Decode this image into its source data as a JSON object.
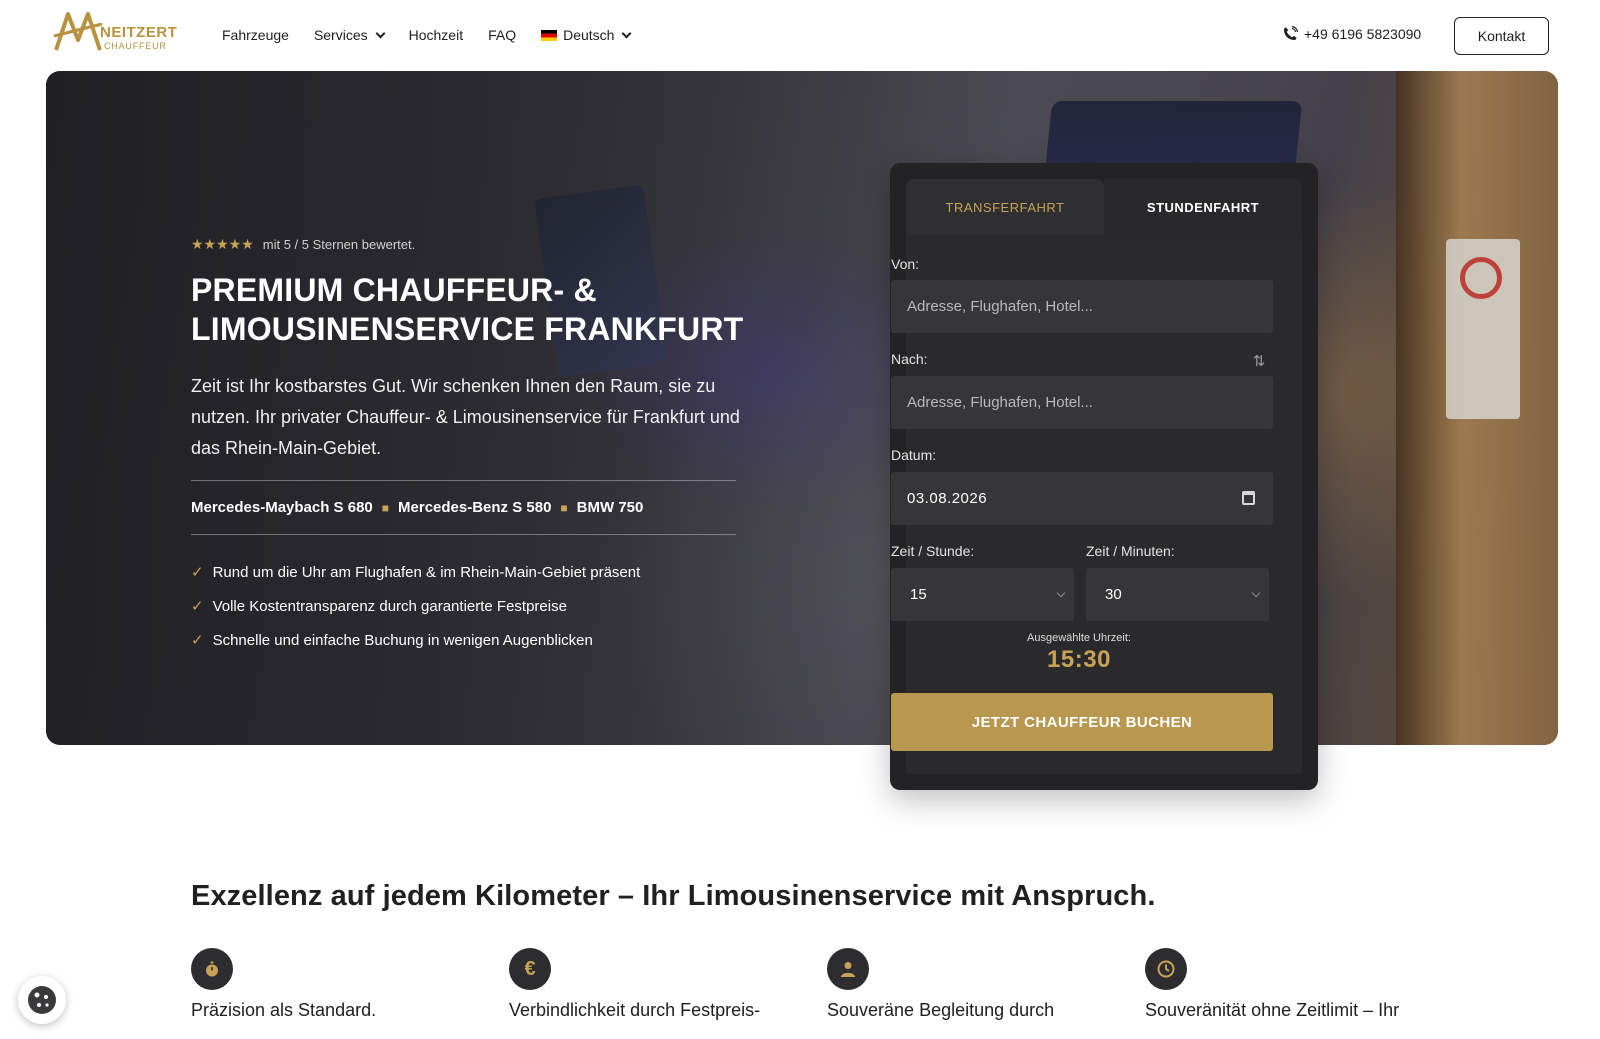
{
  "brand": {
    "name": "NEITZERT",
    "sub": "CHAUFFEUR"
  },
  "nav": {
    "items": [
      {
        "label": "Fahrzeuge",
        "dropdown": false
      },
      {
        "label": "Services",
        "dropdown": true
      },
      {
        "label": "Hochzeit",
        "dropdown": false
      },
      {
        "label": "FAQ",
        "dropdown": false
      }
    ],
    "language": "Deutsch",
    "phone": "+49 6196 5823090",
    "contact_label": "Kontakt"
  },
  "hero": {
    "stars": "★★★★★",
    "rating_text": "mit 5 / 5 Sternen bewertet.",
    "rating_value": 5,
    "rating_max": 5,
    "title_line1": "PREMIUM CHAUFFEUR- &",
    "title_line2": "LIMOUSINENSERVICE FRANKFURT",
    "lead": "Zeit ist Ihr kostbarstes Gut. Wir schenken Ihnen den Raum, sie zu nutzen. Ihr privater Chauffeur- & Limousinenservice für Frankfurt und das Rhein-Main-Gebiet.",
    "cars": [
      "Mercedes-Maybach S 680",
      "Mercedes-Benz S 580",
      "BMW 750"
    ],
    "car_separator": "■",
    "check_mark": "✓",
    "checks": [
      "Rund um die Uhr am Flughafen & im Rhein-Main-Gebiet präsent",
      "Volle Kostentransparenz durch garantierte Festpreise",
      "Schnelle und einfache Buchung in wenigen Augenblicken"
    ]
  },
  "booking": {
    "tabs": [
      "TRANSFERFAHRT",
      "STUNDENFAHRT"
    ],
    "active_tab": "TRANSFERFAHRT",
    "from_label": "Von:",
    "from_placeholder": "Adresse, Flughafen, Hotel...",
    "to_label": "Nach:",
    "to_placeholder": "Adresse, Flughafen, Hotel...",
    "swap_icon": "⇅",
    "date_label": "Datum:",
    "date_value": "03.08.2026",
    "hour_label": "Zeit / Stunde:",
    "hour_value": "15",
    "minute_label": "Zeit / Minuten:",
    "minute_value": "30",
    "selected_time_label": "Ausgewählte Uhrzeit:",
    "selected_time": "15:30",
    "submit_label": "JETZT CHAUFFEUR BUCHEN"
  },
  "intro": {
    "title": "Exzellenz auf jedem Kilometer – Ihr Limousinenservice mit Anspruch."
  },
  "features": [
    {
      "icon": "stopwatch-icon",
      "glyph": "⏱",
      "title": "Präzision als Standard."
    },
    {
      "icon": "euro-icon",
      "glyph": "€",
      "title": "Verbindlichkeit durch Festpreis-"
    },
    {
      "icon": "chauffeur-icon",
      "glyph": "👤",
      "title": "Souveräne Begleitung durch"
    },
    {
      "icon": "clock-icon",
      "glyph": "🕒",
      "title": "Souveränität ohne Zeitlimit – Ihr"
    }
  ],
  "colors": {
    "accent": "#c8a256",
    "button": "#b8974e",
    "panel": "#232325",
    "text_dark": "#1c1c1c"
  }
}
